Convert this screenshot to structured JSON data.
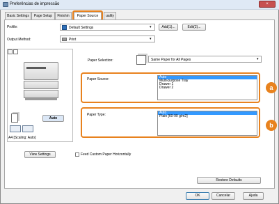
{
  "window": {
    "title": "Preferências de impressão",
    "close_glyph": "×"
  },
  "tabs": [
    {
      "label": "Basic Settings"
    },
    {
      "label": "Page Setup"
    },
    {
      "label": "Finishin"
    },
    {
      "label": "Paper Source"
    },
    {
      "label": "uality"
    }
  ],
  "profile": {
    "label": "Profile:",
    "value": "Default Settings",
    "add_label": "Add(1)...",
    "edit_label": "Edit(2)..."
  },
  "output": {
    "label": "Output Method:",
    "value": "Print"
  },
  "preview": {
    "auto_label": "Auto",
    "caption": "A4 [Scaling: Auto]"
  },
  "paper_selection": {
    "label": "Paper Selection:",
    "value": "Same Paper for All Pages"
  },
  "paper_source": {
    "label": "Paper Source:",
    "options": [
      "Auto",
      "Multi-purpose Tray",
      "Drawer 1",
      "Drawer 2"
    ],
    "selected_index": 0
  },
  "paper_type": {
    "label": "Paper Type:",
    "options": [
      "Auto",
      "Plain [60-90 g/m2]"
    ],
    "selected_index": 0
  },
  "callouts": {
    "a": "a",
    "b": "b"
  },
  "view_settings_label": "View Settings",
  "feed_custom_label": "Feed Custom Paper Horizontally",
  "restore_defaults_label": "Restore Defaults",
  "footer": {
    "ok_label": "OK",
    "cancel_label": "Cancelar",
    "help_label": "Ajuda"
  },
  "colors": {
    "callout": "#e8821e",
    "selection": "#3399ff"
  }
}
